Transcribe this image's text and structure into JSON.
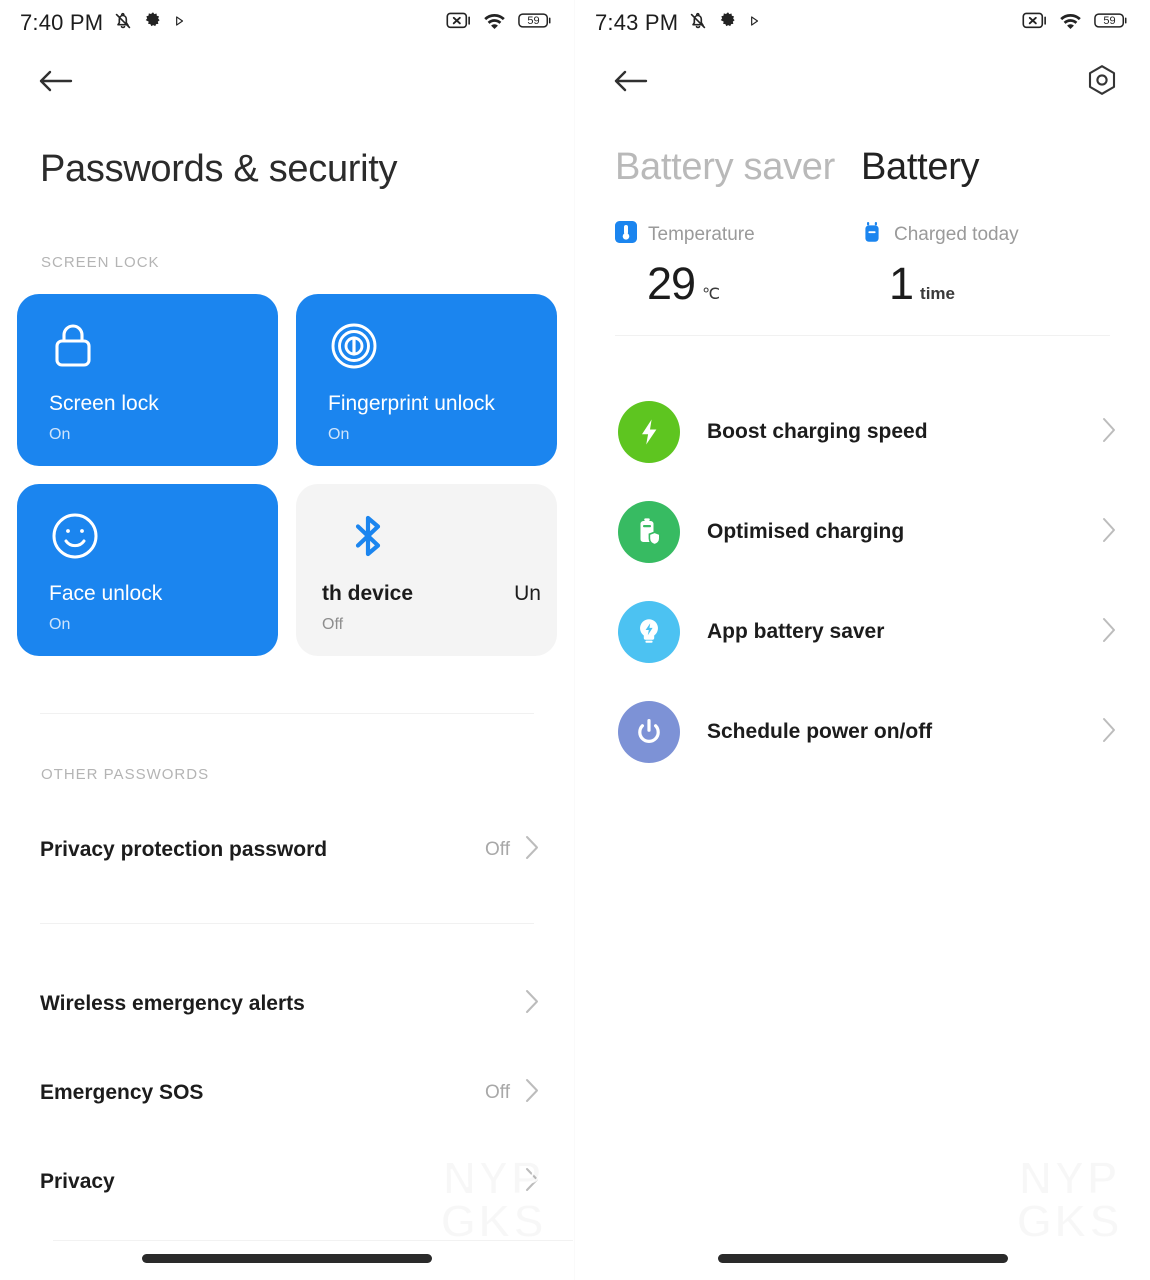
{
  "left": {
    "statusbar": {
      "time": "7:40 PM",
      "left_icons": [
        "silent-mode-icon",
        "gear-icon",
        "play-icon"
      ],
      "right_icons": [
        "no-sim-icon",
        "wifi-icon",
        "battery-icon"
      ],
      "battery_level": "59"
    },
    "nav": {
      "back": "back-arrow-icon"
    },
    "title": "Passwords & security",
    "screen_lock_label": "SCREEN LOCK",
    "tiles": [
      {
        "icon": "lock-icon",
        "title": "Screen lock",
        "sub": "On",
        "style": "blue"
      },
      {
        "icon": "fingerprint-icon",
        "title": "Fingerprint unlock",
        "sub": "On",
        "style": "blue"
      },
      {
        "icon": "face-smile-icon",
        "title": "Face unlock",
        "sub": "On",
        "style": "blue"
      },
      {
        "icon": "bluetooth-icon",
        "title": "th device",
        "sub": "Off",
        "style": "grey",
        "aux": "Un"
      }
    ],
    "other_passwords_label": "OTHER PASSWORDS",
    "rows": [
      {
        "label": "Privacy protection password",
        "value": "Off"
      },
      {
        "label": "Wireless emergency alerts",
        "value": ""
      },
      {
        "label": "Emergency SOS",
        "value": "Off"
      },
      {
        "label": "Privacy",
        "value": ""
      }
    ],
    "watermark": [
      "NYP",
      "GKS"
    ]
  },
  "right": {
    "statusbar": {
      "time": "7:43 PM",
      "left_icons": [
        "silent-mode-icon",
        "gear-icon",
        "play-icon"
      ],
      "right_icons": [
        "no-sim-icon",
        "wifi-icon",
        "battery-icon"
      ],
      "battery_level": "59"
    },
    "nav": {
      "back": "back-arrow-icon",
      "settings": "settings-hex-icon"
    },
    "tabs": [
      {
        "label": "Battery saver",
        "active": false
      },
      {
        "label": "Battery",
        "active": true
      }
    ],
    "stats": [
      {
        "icon": "thermometer-icon",
        "name": "Temperature",
        "value": "29",
        "unit": "℃"
      },
      {
        "icon": "charge-plug-icon",
        "name": "Charged today",
        "value": "1",
        "unit": "time"
      }
    ],
    "menu": [
      {
        "icon": "bolt-icon",
        "label": "Boost charging speed",
        "color": "#5ec520"
      },
      {
        "icon": "battery-shield-icon",
        "label": "Optimised charging",
        "color": "#37bb62"
      },
      {
        "icon": "bulb-bolt-icon",
        "label": "App battery saver",
        "color": "#4cc2f2"
      },
      {
        "icon": "power-icon",
        "label": "Schedule power on/off",
        "color": "#7d92d6"
      }
    ],
    "watermark": [
      "NYP",
      "GKS"
    ]
  },
  "colors": {
    "tile_blue": "#1b85ef",
    "tile_grey": "#f4f4f4",
    "accent_blue": "#1b85ef",
    "text_primary": "#1c1c1c",
    "text_muted": "#a8a8a8"
  }
}
